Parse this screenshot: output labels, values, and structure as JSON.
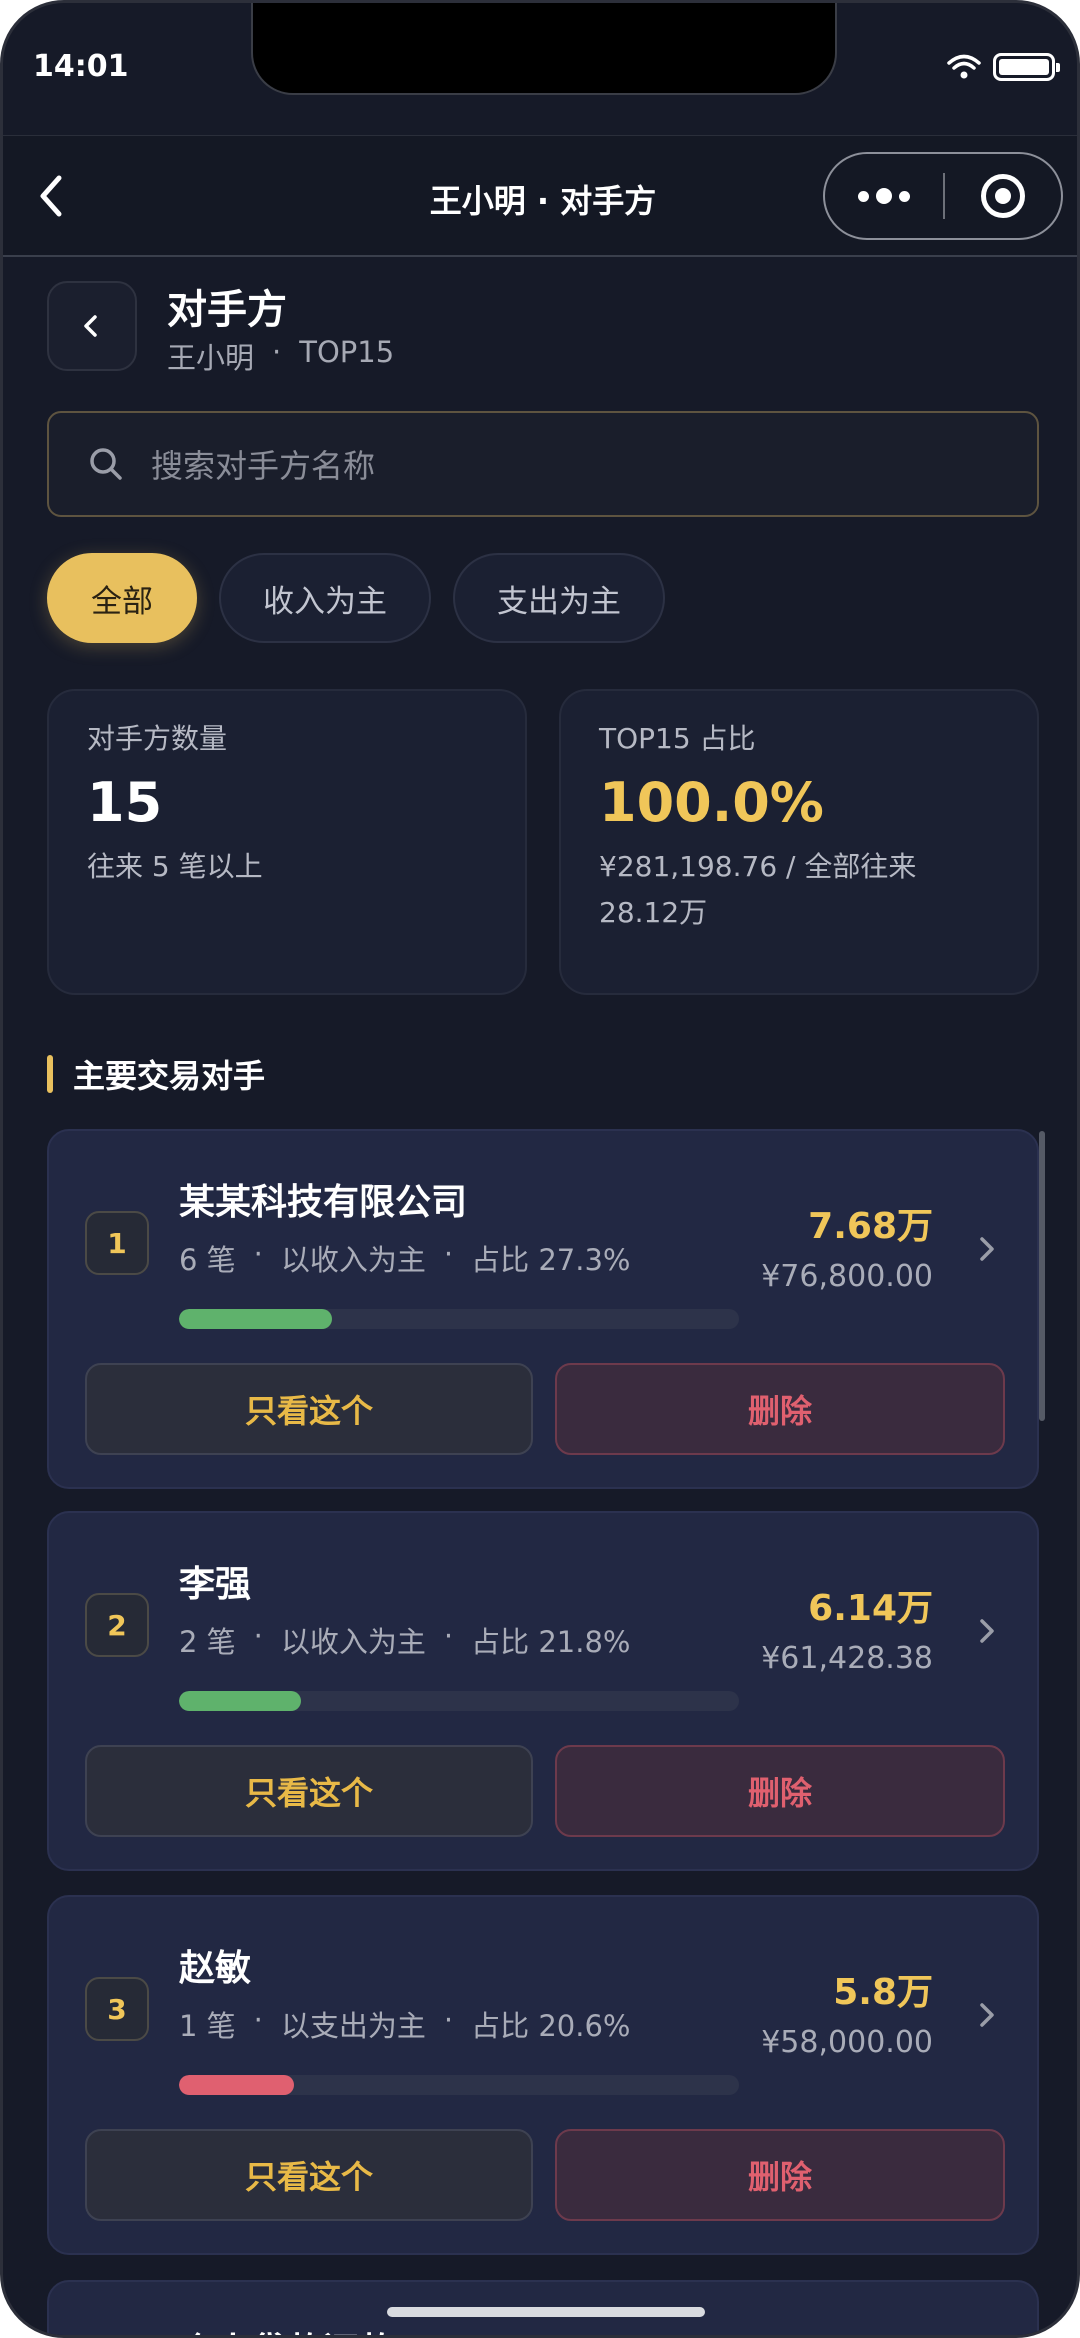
{
  "status_bar": {
    "time": "14:01"
  },
  "navbar": {
    "title": "王小明 · 对手方"
  },
  "header": {
    "title": "对手方",
    "subtitle_name": "王小明",
    "subtitle_sep": "·",
    "subtitle_tag": "TOP15"
  },
  "search": {
    "placeholder": "搜索对手方名称"
  },
  "filters": [
    {
      "label": "全部",
      "active": true
    },
    {
      "label": "收入为主",
      "active": false
    },
    {
      "label": "支出为主",
      "active": false
    }
  ],
  "stats": {
    "count": {
      "label": "对手方数量",
      "value": "15",
      "note": "往来 5 笔以上"
    },
    "share": {
      "label": "TOP15 占比",
      "value": "100.0%",
      "note": "¥281,198.76 / 全部往来 28.12万"
    }
  },
  "section": {
    "title": "主要交易对手"
  },
  "counterparties": [
    {
      "rank": "1",
      "name": "某某科技有限公司",
      "count": "6 笔",
      "type": "以收入为主",
      "share": "占比 27.3%",
      "share_value": 27.3,
      "amount_short": "7.68万",
      "amount_full": "¥76,800.00",
      "bar_color": "#5fb26c",
      "only_label": "只看这个",
      "delete_label": "删除"
    },
    {
      "rank": "2",
      "name": "李强",
      "count": "2 笔",
      "type": "以收入为主",
      "share": "占比 21.8%",
      "share_value": 21.8,
      "amount_short": "6.14万",
      "amount_full": "¥61,428.38",
      "bar_color": "#5fb26c",
      "only_label": "只看这个",
      "delete_label": "删除"
    },
    {
      "rank": "3",
      "name": "赵敏",
      "count": "1 笔",
      "type": "以支出为主",
      "share": "占比 20.6%",
      "share_value": 20.6,
      "amount_short": "5.8万",
      "amount_full": "¥58,000.00",
      "bar_color": "#e06070",
      "only_label": "只看这个",
      "delete_label": "删除"
    }
  ],
  "peek": {
    "name": "个人贷款还款"
  },
  "meta_sep": "·",
  "colors": {
    "accent": "#e8c05e",
    "income": "#5fb26c",
    "expense": "#e06070",
    "background": "#161a28"
  }
}
